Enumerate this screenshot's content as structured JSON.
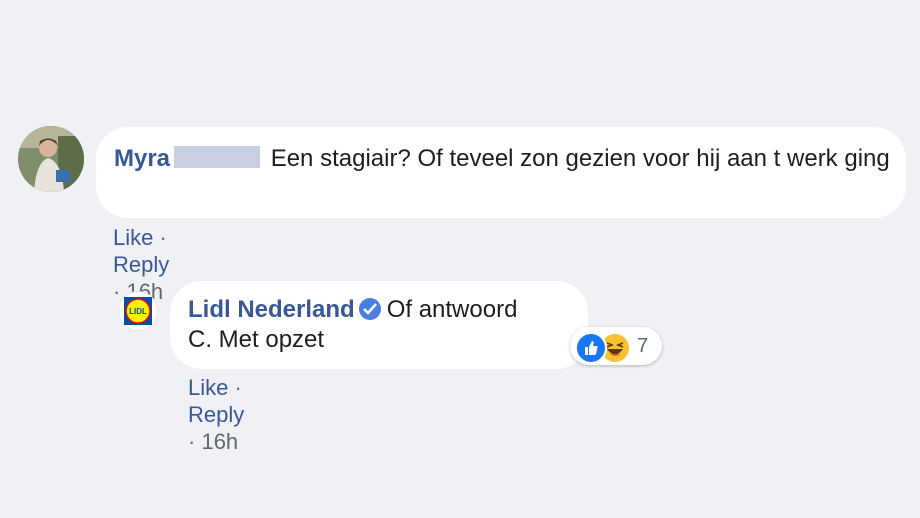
{
  "comments": [
    {
      "author": "Myra",
      "text": "Een stagiair? Of teveel zon gezien voor hij aan t werk ging",
      "actions": {
        "like": "Like",
        "reply": "Reply",
        "separator": "·",
        "time": "16h"
      }
    },
    {
      "author": "Lidl Nederland",
      "text_line1": "Of antwoord",
      "text_line2": "C. Met opzet",
      "actions": {
        "like": "Like",
        "reply": "Reply",
        "separator": "·",
        "time": "16h"
      },
      "reactions": {
        "icons": [
          "like-icon",
          "haha-icon"
        ],
        "count": "7"
      },
      "logo_text": "LIDL"
    }
  ],
  "colors": {
    "background": "#f0f1f4",
    "link": "#385898",
    "meta": "#606770",
    "verified": "#4a7ee0",
    "like": "#1877f2",
    "haha": "#f7c232"
  }
}
